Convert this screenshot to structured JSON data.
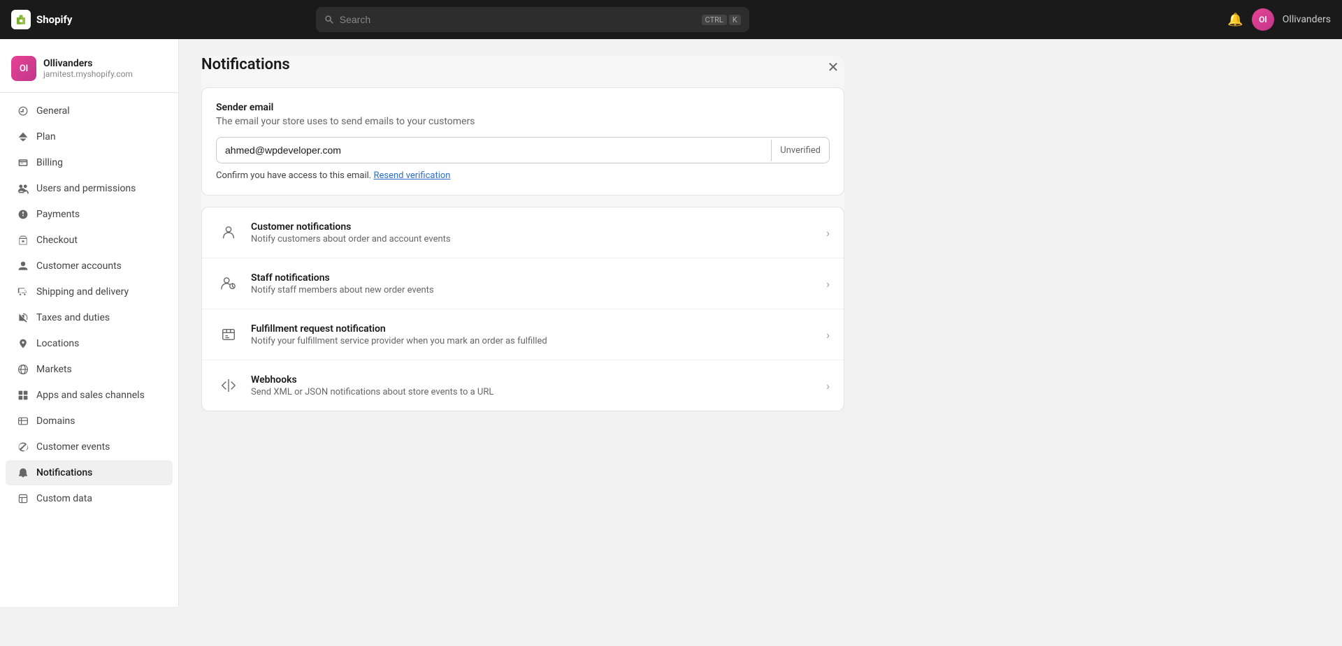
{
  "topnav": {
    "logo_text": "Shopify",
    "search_placeholder": "Search",
    "search_kbd1": "CTRL",
    "search_kbd2": "K",
    "username": "Ollivanders",
    "avatar_initials": "Ol"
  },
  "sidebar": {
    "store_name": "Ollivanders",
    "store_url": "jamitest.myshopify.com",
    "avatar_initials": "Ol",
    "items": [
      {
        "id": "general",
        "label": "General",
        "icon": "general"
      },
      {
        "id": "plan",
        "label": "Plan",
        "icon": "plan"
      },
      {
        "id": "billing",
        "label": "Billing",
        "icon": "billing"
      },
      {
        "id": "users-permissions",
        "label": "Users and permissions",
        "icon": "users"
      },
      {
        "id": "payments",
        "label": "Payments",
        "icon": "payments"
      },
      {
        "id": "checkout",
        "label": "Checkout",
        "icon": "checkout"
      },
      {
        "id": "customer-accounts",
        "label": "Customer accounts",
        "icon": "customer-accounts"
      },
      {
        "id": "shipping",
        "label": "Shipping and delivery",
        "icon": "shipping"
      },
      {
        "id": "taxes",
        "label": "Taxes and duties",
        "icon": "taxes"
      },
      {
        "id": "locations",
        "label": "Locations",
        "icon": "locations"
      },
      {
        "id": "markets",
        "label": "Markets",
        "icon": "markets"
      },
      {
        "id": "apps",
        "label": "Apps and sales channels",
        "icon": "apps"
      },
      {
        "id": "domains",
        "label": "Domains",
        "icon": "domains"
      },
      {
        "id": "customer-events",
        "label": "Customer events",
        "icon": "customer-events"
      },
      {
        "id": "notifications",
        "label": "Notifications",
        "icon": "notifications",
        "active": true
      },
      {
        "id": "custom-data",
        "label": "Custom data",
        "icon": "custom-data"
      }
    ]
  },
  "page": {
    "title": "Notifications",
    "sender_email_label": "Sender email",
    "sender_email_desc": "The email your store uses to send emails to your customers",
    "email_value": "ahmed@wpdeveloper.com",
    "unverified_label": "Unverified",
    "verify_text": "Confirm you have access to this email.",
    "resend_label": "Resend verification",
    "notifications": [
      {
        "id": "customer",
        "title": "Customer notifications",
        "desc": "Notify customers about order and account events",
        "icon": "customer"
      },
      {
        "id": "staff",
        "title": "Staff notifications",
        "desc": "Notify staff members about new order events",
        "icon": "staff"
      },
      {
        "id": "fulfillment",
        "title": "Fulfillment request notification",
        "desc": "Notify your fulfillment service provider when you mark an order as fulfilled",
        "icon": "fulfillment"
      },
      {
        "id": "webhooks",
        "title": "Webhooks",
        "desc": "Send XML or JSON notifications about store events to a URL",
        "icon": "webhooks"
      }
    ]
  }
}
